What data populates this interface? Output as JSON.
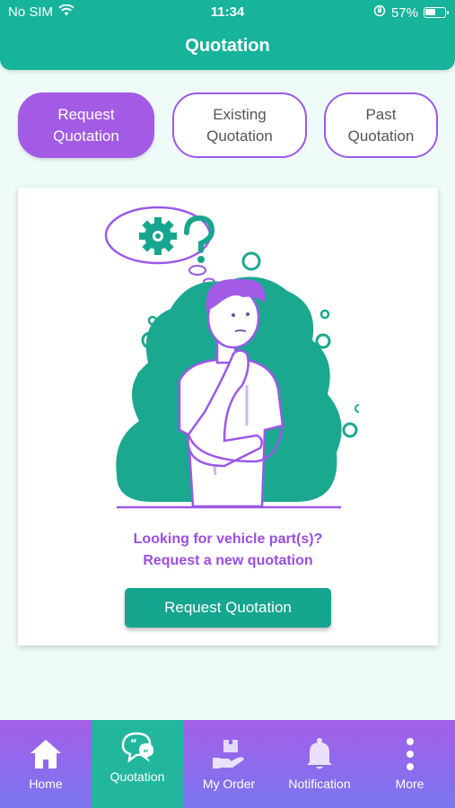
{
  "status_bar": {
    "carrier": "No SIM",
    "time": "11:34",
    "battery_percent": "57%",
    "battery_level": 0.57
  },
  "header": {
    "title": "Quotation"
  },
  "tabs": [
    {
      "label": "Request\nQuotation",
      "active": true
    },
    {
      "label": "Existing\nQuotation",
      "active": false
    },
    {
      "label": "Past\nQuotation",
      "active": false
    }
  ],
  "card": {
    "prompt_line1": "Looking for vehicle part(s)?",
    "prompt_line2": "Request a new quotation",
    "cta_label": "Request Quotation"
  },
  "bottom_nav": [
    {
      "label": "Home",
      "icon": "home-icon",
      "active": false
    },
    {
      "label": "Quotation",
      "icon": "quotation-chat-icon",
      "active": true
    },
    {
      "label": "My Order",
      "icon": "order-box-icon",
      "active": false
    },
    {
      "label": "Notification",
      "icon": "bell-icon",
      "active": false
    },
    {
      "label": "More",
      "icon": "more-dots-icon",
      "active": false
    }
  ],
  "colors": {
    "primary_teal": "#17b39a",
    "accent_purple": "#a35be6",
    "nav_gradient_top": "#a45ee8",
    "nav_gradient_bottom": "#7a76f0"
  }
}
